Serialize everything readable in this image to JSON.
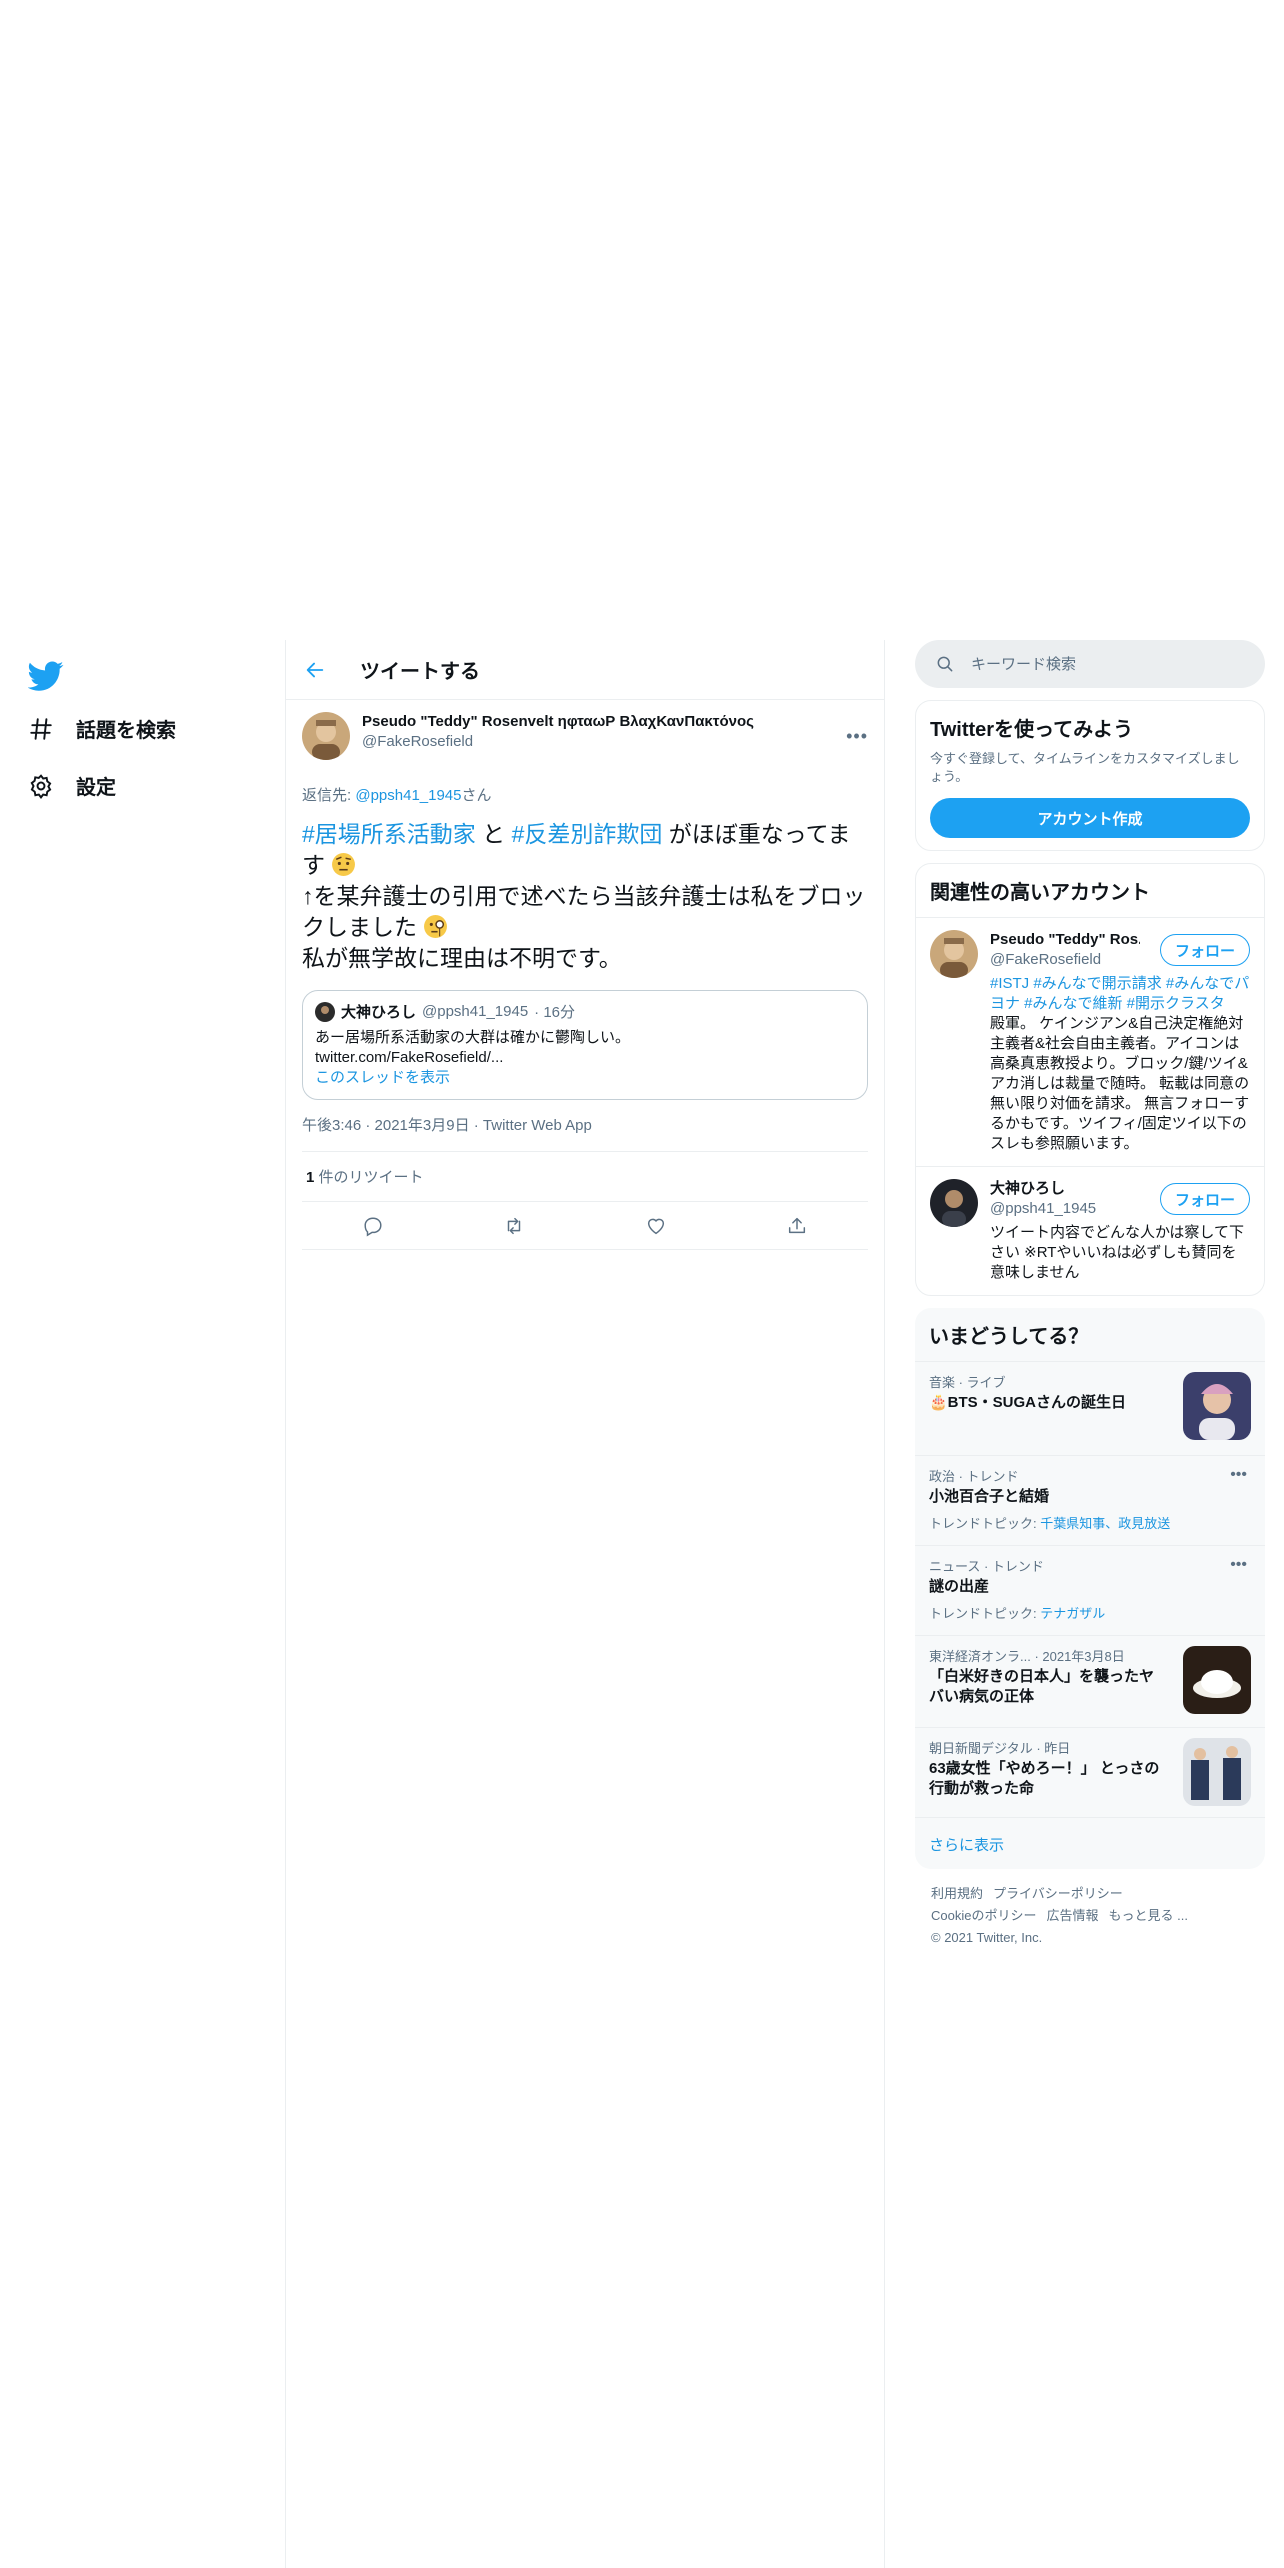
{
  "nav": {
    "items": [
      {
        "label": "話題を検索",
        "icon": "hashtag-icon"
      },
      {
        "label": "設定",
        "icon": "gear-icon"
      }
    ]
  },
  "header": {
    "title": "ツイートする"
  },
  "tweet": {
    "author_name": "Pseudo \"Teddy\" Rosenvelt ηφταωΡ ΒλαχΚανΠακτόνος",
    "author_handle": "@FakeRosefield",
    "reply_prefix": "返信先: ",
    "reply_handle": "@ppsh41_1945",
    "reply_suffix": "さん",
    "hashtag1": "#居場所系活動家",
    "text_and": " と ",
    "hashtag2": "#反差別詐欺団",
    "line1_rest": " がほぼ重なってます",
    "line2": "↑を某弁護士の引用で述べたら当該弁護士は私をブロックしました",
    "line3": "私が無学故に理由は不明です。",
    "quote": {
      "name": "大神ひろし",
      "handle": "@ppsh41_1945",
      "time": "· 16分",
      "text1": "あー居場所系活動家の大群は確かに鬱陶しい。",
      "text2": "twitter.com/FakeRosefield/...",
      "thread_link": "このスレッドを表示"
    },
    "meta": "午後3:46 · 2021年3月9日 · Twitter Web App",
    "retweet_count": "1",
    "retweet_label": " 件のリツイート"
  },
  "search": {
    "placeholder": "キーワード検索"
  },
  "signup": {
    "title": "Twitterを使ってみよう",
    "desc": "今すぐ登録して、タイムラインをカスタマイズしましょう。",
    "button": "アカウント作成"
  },
  "related": {
    "title": "関連性の高いアカウント",
    "follow_label": "フォロー",
    "accounts": [
      {
        "name": "Pseudo \"Teddy\" Ros...",
        "handle": "@FakeRosefield",
        "bio_tags": "#ISTJ #みんなで開示請求 #みんなでパヨナ #みんなで維新 #開示クラスタ",
        "bio": "殿軍。 ケインジアン&自己決定権絶対主義者&社会自由主義者。アイコンは高桑真恵教授より。ブロック/鍵/ツイ&アカ消しは裁量で随時。 転載は同意の無い限り対価を請求。 無言フォローするかもです。ツイフィ/固定ツイ以下のスレも参照願います。"
      },
      {
        "name": "大神ひろし",
        "handle": "@ppsh41_1945",
        "bio": "ツイート内容でどんな人かは察して下さい ※RTやいいねは必ずしも賛同を意味しません"
      }
    ]
  },
  "trends": {
    "title": "いまどうしてる？",
    "items": [
      {
        "context": "音楽 · ライブ",
        "title": "🎂BTS・SUGAさんの誕生日"
      },
      {
        "context": "政治 · トレンド",
        "title": "小池百合子と結婚",
        "sub_prefix": "トレンドトピック: ",
        "sub_links": "千葉県知事、政見放送"
      },
      {
        "context": "ニュース · トレンド",
        "title": "謎の出産",
        "sub_prefix": "トレンドトピック: ",
        "sub_links": "テナガザル"
      },
      {
        "context": "東洋経済オンラ... · 2021年3月8日",
        "title": "「白米好きの日本人」を襲ったヤバい病気の正体"
      },
      {
        "context": "朝日新聞デジタル · 昨日",
        "title": "63歳女性「やめろー！」 とっさの行動が救った命"
      }
    ],
    "more": "さらに表示"
  },
  "footer": {
    "l1a": "利用規約",
    "l1b": "プライバシーポリシー",
    "l2a": "Cookieのポリシー",
    "l2b": "広告情報",
    "l2c": "もっと見る ...",
    "copyright": "© 2021 Twitter, Inc."
  },
  "colors": {
    "accent": "#1da1f2",
    "link": "#1b95e0",
    "muted": "#5b7083",
    "border": "#ebeef0"
  }
}
